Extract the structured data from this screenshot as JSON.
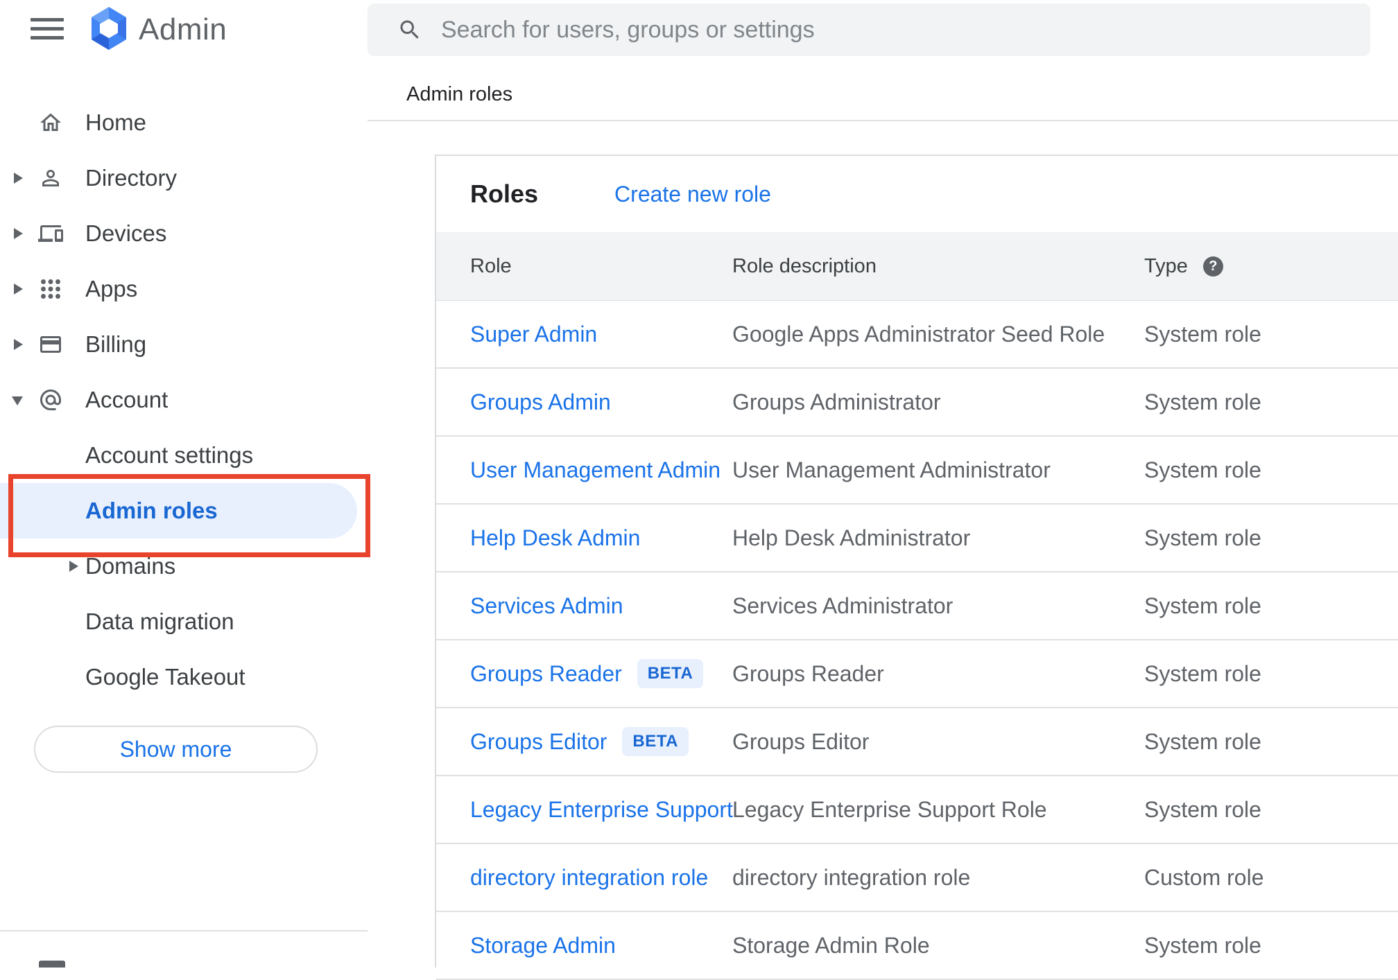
{
  "topbar": {
    "logo_text": "Admin",
    "search_placeholder": "Search for users, groups or settings"
  },
  "breadcrumb": {
    "label": "Admin roles"
  },
  "sidebar": {
    "items": [
      {
        "label": "Home",
        "icon": "home-icon",
        "expandable": false
      },
      {
        "label": "Directory",
        "icon": "person-icon",
        "expandable": true
      },
      {
        "label": "Devices",
        "icon": "devices-icon",
        "expandable": true
      },
      {
        "label": "Apps",
        "icon": "apps-grid-icon",
        "expandable": true
      },
      {
        "label": "Billing",
        "icon": "credit-card-icon",
        "expandable": true
      },
      {
        "label": "Account",
        "icon": "at-icon",
        "expandable": true,
        "expanded": true
      }
    ],
    "account_children": [
      {
        "label": "Account settings"
      },
      {
        "label": "Admin roles",
        "selected": true
      },
      {
        "label": "Domains",
        "expandable": true
      },
      {
        "label": "Data migration"
      },
      {
        "label": "Google Takeout"
      }
    ],
    "show_more_label": "Show more"
  },
  "panel": {
    "title": "Roles",
    "create_link": "Create new role",
    "columns": [
      "Role",
      "Role description",
      "Type"
    ],
    "help_glyph": "?",
    "rows": [
      {
        "role": "Super Admin",
        "description": "Google Apps Administrator Seed Role",
        "type": "System role"
      },
      {
        "role": "Groups Admin",
        "description": "Groups Administrator",
        "type": "System role"
      },
      {
        "role": "User Management Admin",
        "description": "User Management Administrator",
        "type": "System role"
      },
      {
        "role": "Help Desk Admin",
        "description": "Help Desk Administrator",
        "type": "System role"
      },
      {
        "role": "Services Admin",
        "description": "Services Administrator",
        "type": "System role"
      },
      {
        "role": "Groups Reader",
        "badge": "BETA",
        "description": "Groups Reader",
        "type": "System role"
      },
      {
        "role": "Groups Editor",
        "badge": "BETA",
        "description": "Groups Editor",
        "type": "System role"
      },
      {
        "role": "Legacy Enterprise Support",
        "description": "Legacy Enterprise Support Role",
        "type": "System role"
      },
      {
        "role": "directory integration role",
        "description": "directory integration role",
        "type": "Custom role"
      },
      {
        "role": "Storage Admin",
        "description": "Storage Admin Role",
        "type": "System role"
      }
    ]
  },
  "colors": {
    "link_blue": "#1a73e8",
    "selected_blue": "#1967d2",
    "selected_pill_bg": "#e8f0fe",
    "beta_badge_bg": "#e8f0fe",
    "table_header_bg": "#f1f3f4",
    "search_bg": "#f1f3f4",
    "divider": "#e0e0e0",
    "annotation_red": "#e8432c",
    "icon_gray": "#5f6368"
  }
}
